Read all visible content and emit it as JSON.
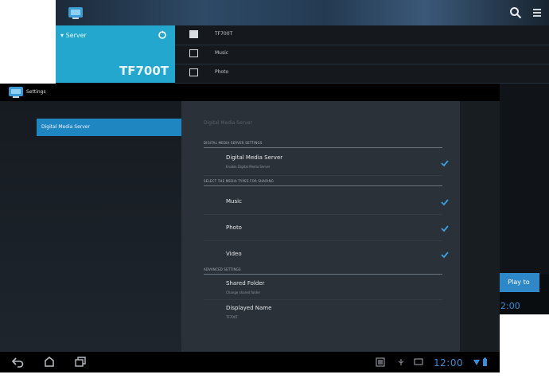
{
  "back_screen": {
    "server_label": "Server",
    "device_name": "TF700T",
    "list": [
      {
        "label": "TF700T"
      },
      {
        "label": "Music"
      },
      {
        "label": "Photo"
      }
    ],
    "play_button": "Play to",
    "clock": "12:00"
  },
  "front_screen": {
    "title": "Settings",
    "left_items": [
      {
        "label": "Digital Media Server"
      }
    ],
    "header": "Digital Media Server",
    "sections": {
      "dms": "DIGITAL MEDIA SERVER SETTINGS",
      "media": "SELECT THE MEDIA TYPES FOR SHARING",
      "advanced": "ADVANCED SETTINGS"
    },
    "rows": {
      "dms": {
        "label": "Digital Media Server",
        "sub": "Enable Digital Media Server"
      },
      "music": {
        "label": "Music"
      },
      "photo": {
        "label": "Photo"
      },
      "video": {
        "label": "Video"
      },
      "shared": {
        "label": "Shared Folder",
        "sub": "Change shared folder"
      },
      "name": {
        "label": "Displayed Name",
        "sub": "TF700T"
      }
    },
    "clock": "12:00"
  },
  "icons": {
    "app": "asus-app-icon",
    "search": "search-icon",
    "menu": "menu-icon",
    "refresh": "refresh-icon",
    "check": "check-icon",
    "back": "back-icon",
    "home": "home-icon",
    "recent": "recent-apps-icon"
  },
  "colors": {
    "accent": "#1f86c2",
    "server_panel": "#23a7cf",
    "clock": "#3a8dd6"
  }
}
